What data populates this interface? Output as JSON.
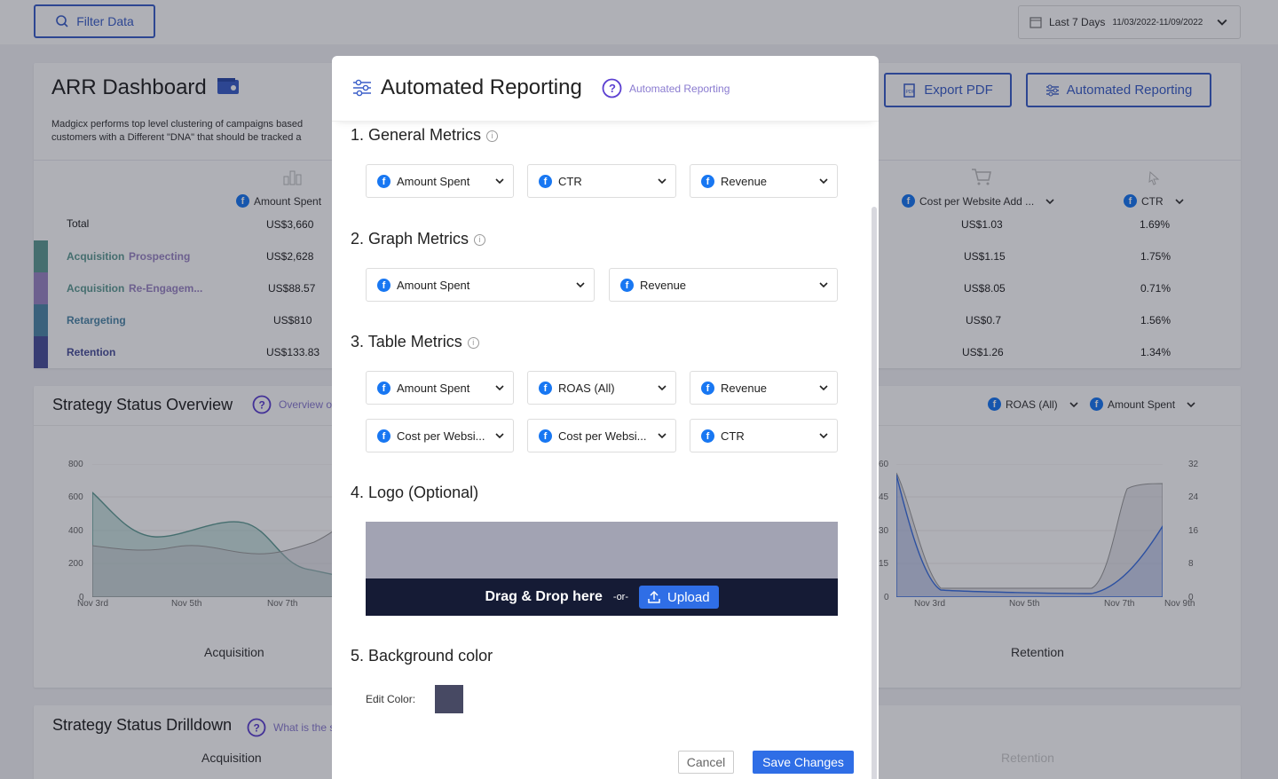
{
  "topbar": {
    "filter_label": "Filter Data",
    "date_label": "Last 7 Days",
    "date_range": "11/03/2022-11/09/2022"
  },
  "dashboard": {
    "title": "ARR Dashboard",
    "description": "Madgicx performs top level clustering of campaigns based customers with a Different \"DNA\" that should be tracked a",
    "export_label": "Export PDF",
    "automated_label": "Automated Reporting",
    "columns": {
      "amount_spent": "Amount Spent",
      "cost_per_add": "Cost per Website Add ...",
      "ctr": "CTR"
    },
    "rows": [
      {
        "label_a": "Total",
        "label_b": "",
        "spent": "US$3,660",
        "cost": "US$1.03",
        "ctr": "1.69%",
        "color": ""
      },
      {
        "label_a": "Acquisition",
        "label_b": "Prospecting",
        "spent": "US$2,628",
        "cost": "US$1.15",
        "ctr": "1.75%",
        "color": "#5f9c93"
      },
      {
        "label_a": "Acquisition",
        "label_b": "Re-Engagem...",
        "spent": "US$88.57",
        "cost": "US$8.05",
        "ctr": "0.71%",
        "color": "#9b86c4"
      },
      {
        "label_a": "Retargeting",
        "label_b": "",
        "spent": "US$810",
        "cost": "US$0.7",
        "ctr": "1.56%",
        "color": "#4e87a8"
      },
      {
        "label_a": "Retention",
        "label_b": "",
        "spent": "US$133.83",
        "cost": "US$1.26",
        "ctr": "1.34%",
        "color": "#4a4f9a"
      }
    ]
  },
  "strategy": {
    "title": "Strategy Status Overview",
    "overview_link": "Overview o",
    "metric_a": "ROAS (All)",
    "metric_b": "Amount Spent",
    "left_chart": {
      "caption": "Acquisition",
      "y_ticks": [
        "800",
        "600",
        "400",
        "200",
        "0"
      ],
      "x_ticks": [
        "Nov 3rd",
        "Nov 5th",
        "Nov 7th"
      ]
    },
    "right_chart": {
      "caption": "Retention",
      "y_left_ticks": [
        "60",
        "45",
        "30",
        "15",
        "0"
      ],
      "y_right_ticks": [
        "32",
        "24",
        "16",
        "8",
        "0"
      ],
      "x_ticks": [
        "Nov 3rd",
        "Nov 5th",
        "Nov 7th",
        "Nov 9th"
      ]
    }
  },
  "drilldown": {
    "title": "Strategy Status Drilldown",
    "link": "What is the s",
    "col_a": "Acquisition",
    "col_b": "Retention"
  },
  "modal": {
    "title": "Automated Reporting",
    "subtitle": "Automated Reporting",
    "sec1": "1. General Metrics",
    "sec2": "2. Graph Metrics",
    "sec3": "3. Table Metrics",
    "sec4": "4. Logo (Optional)",
    "sec5": "5. Background color",
    "general": [
      "Amount Spent",
      "CTR",
      "Revenue"
    ],
    "graph": [
      "Amount Spent",
      "Revenue"
    ],
    "table": [
      "Amount Spent",
      "ROAS (All)",
      "Revenue",
      "Cost per Websi...",
      "Cost per Websi...",
      "CTR"
    ],
    "drop_text": "Drag & Drop here",
    "or_text": "-or-",
    "upload_label": "Upload",
    "edit_color_label": "Edit Color:",
    "bg_color": "#474963",
    "cancel_label": "Cancel",
    "save_label": "Save Changes"
  }
}
